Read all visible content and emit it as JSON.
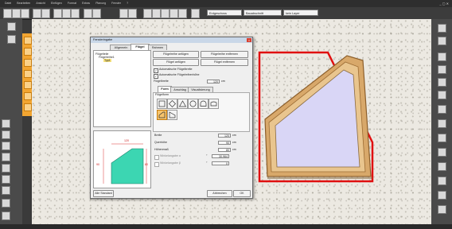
{
  "menu": [
    "Datei",
    "Bearbeiten",
    "Ansicht",
    "Einfügen",
    "Format",
    "Extras",
    "Planung",
    "Fenster",
    "?"
  ],
  "window_controls": "_ ▢ ✕",
  "toolbar": {
    "floor_select": "Erdgeschoss",
    "section_select": "Bauabschnitt",
    "layer_select": "kein Layer"
  },
  "dialog": {
    "title": "Fensteringabe",
    "tabs": [
      "Allgemein",
      "Flügel",
      "Rahmen"
    ],
    "active_tab": "Flügel",
    "tree": [
      "Flügelteile",
      "Flügelreihe1",
      "Typ1"
    ],
    "buttons": {
      "add_row": "Flügelreihe anfügen",
      "remove_row": "Flügelreihe entfernen",
      "add_sash": "Flügel anfügen",
      "remove_sash": "Flügel entfernen"
    },
    "checkboxes": {
      "auto_width": "Automatische Flügelbreite",
      "auto_height": "Automatische Flügelreihenhöhe"
    },
    "sash_width_label": "Flügelbreite",
    "sash_width_value": "120",
    "sash_width_unit": "cm",
    "subtabs": [
      "Form",
      "Anschlag",
      "Visualisierung"
    ],
    "active_subtab": "Form",
    "shapes_group_label": "Flügelform",
    "props": {
      "width_label": "Breite",
      "width_value": "120",
      "width_unit": "cm",
      "height_r_label": "Querhöhe",
      "height_r_value": "90",
      "height_r_unit": "cm",
      "height_l_label": "Höhenmaß",
      "height_l_value": "80",
      "height_l_unit": "cm",
      "angle_a_label": "Winkelangabe α",
      "angle_a_value": "30.964",
      "angle_b_label": "Winkelangabe β",
      "angle_b_value": "0",
      "angle_unit": "°"
    },
    "preview_labels": {
      "top": "120",
      "left": "90",
      "right": "80"
    },
    "footer": {
      "default": "Alle Standard",
      "cancel": "Abbrechen",
      "ok": "OK"
    }
  }
}
